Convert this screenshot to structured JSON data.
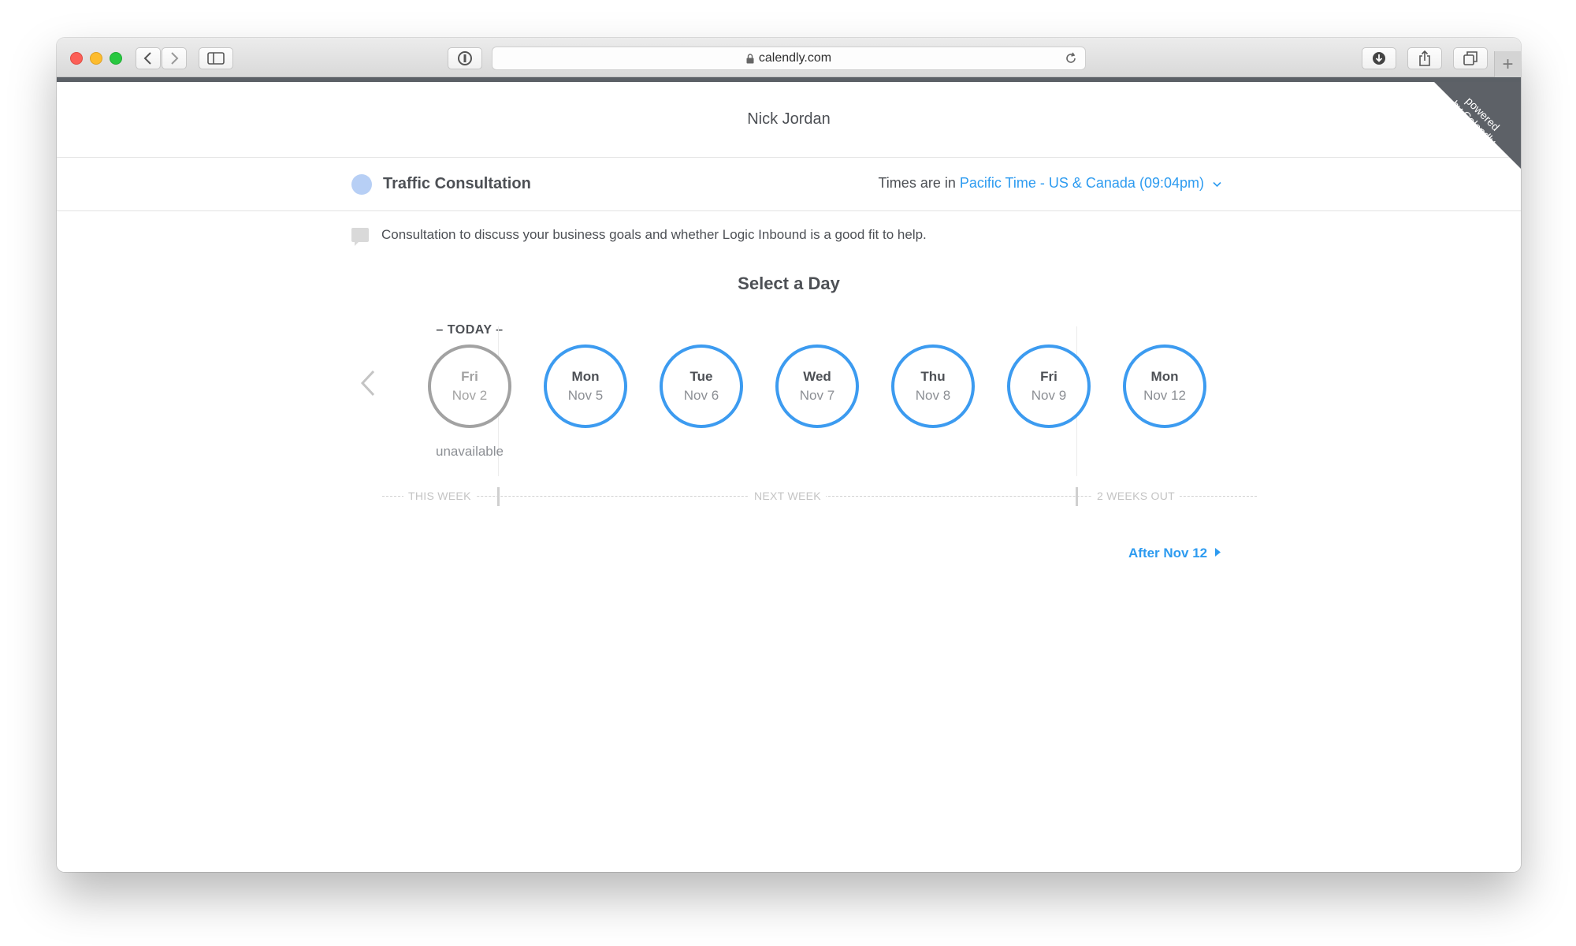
{
  "browser": {
    "url": "calendly.com",
    "new_tab": "+"
  },
  "ribbon": {
    "line1": "powered",
    "line2": "by Calendly"
  },
  "header": {
    "name": "Nick Jordan"
  },
  "event": {
    "title": "Traffic Consultation",
    "tz_prefix": "Times are in",
    "tz_value": "Pacific Time - US & Canada (09:04pm)",
    "description": "Consultation to discuss your business goals and whether Logic Inbound is a good fit to help.",
    "dot_color": "#b7cff5"
  },
  "picker": {
    "title": "Select a Day",
    "today_label": "– TODAY –",
    "unavailable_label": "unavailable",
    "days": [
      {
        "weekday": "Fri",
        "date": "Nov 2",
        "available": false
      },
      {
        "weekday": "Mon",
        "date": "Nov 5",
        "available": true
      },
      {
        "weekday": "Tue",
        "date": "Nov 6",
        "available": true
      },
      {
        "weekday": "Wed",
        "date": "Nov 7",
        "available": true
      },
      {
        "weekday": "Thu",
        "date": "Nov 8",
        "available": true
      },
      {
        "weekday": "Fri",
        "date": "Nov 9",
        "available": true
      },
      {
        "weekday": "Mon",
        "date": "Nov 12",
        "available": true
      }
    ],
    "weeks": [
      "THIS WEEK",
      "NEXT WEEK",
      "2 WEEKS OUT"
    ],
    "after_link": "After Nov 12",
    "accent_color": "#3c9bf0"
  }
}
